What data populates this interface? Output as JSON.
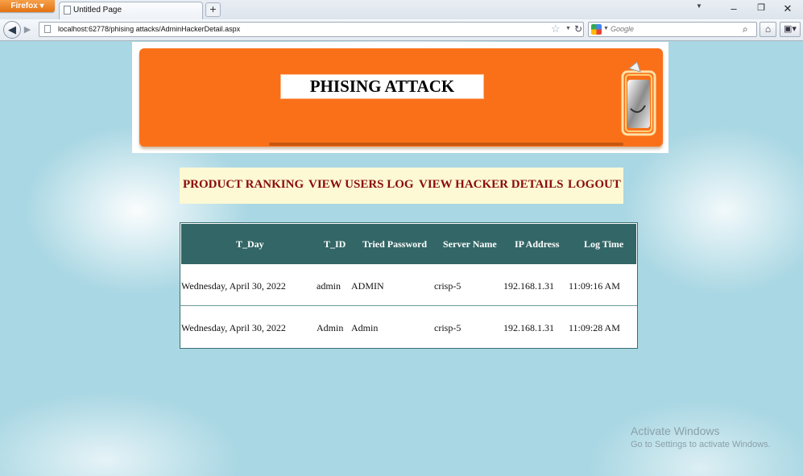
{
  "browser": {
    "app_button": "Firefox",
    "tab_title": "Untitled Page",
    "new_tab": "+",
    "url": "localhost:62778/phising attacks/AdminHackerDetail.aspx",
    "search_placeholder": "Google",
    "window_controls": {
      "minimize": "–",
      "restore": "❐",
      "close": "✕"
    }
  },
  "page": {
    "banner_title": "PHISING ATTACK",
    "menu": [
      {
        "label": "PRODUCT RANKING"
      },
      {
        "label": "VIEW USERS LOG"
      },
      {
        "label": "VIEW HACKER DETAILS"
      },
      {
        "label": "LOGOUT"
      }
    ],
    "table": {
      "columns": [
        "T_Day",
        "T_ID",
        "Tried Password",
        "Server Name",
        "IP Address",
        "Log Time"
      ],
      "rows": [
        [
          "Wednesday, April 30, 2022",
          "admin",
          "ADMIN",
          "crisp-5",
          "192.168.1.31",
          "11:09:16 AM"
        ],
        [
          "Wednesday, April 30, 2022",
          "Admin",
          "Admin",
          "crisp-5",
          "192.168.1.31",
          "11:09:28 AM"
        ]
      ],
      "header_color": "#336666"
    }
  },
  "watermark": {
    "line1": "Activate Windows",
    "line2": "Go to Settings to activate Windows."
  },
  "colors": {
    "banner": "#fa7019",
    "menu_background": "#fcf9d4",
    "menu_text": "#8b0a0a"
  }
}
